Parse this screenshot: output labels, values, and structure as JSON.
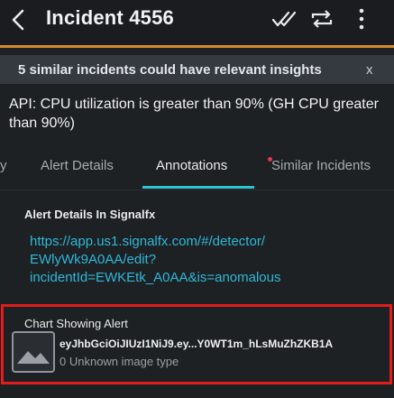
{
  "header": {
    "title": "Incident 4556",
    "back_icon": "chevron-left-icon",
    "actions": [
      "acknowledge-icon",
      "repeat-icon",
      "more-vertical-icon"
    ]
  },
  "banner": {
    "text": "5 similar incidents could have relevant insights",
    "close": "x"
  },
  "incident": {
    "title": "API: CPU utilization is greater than 90% (GH CPU greater than 90%)"
  },
  "tabs": [
    {
      "label": "y",
      "active": false
    },
    {
      "label": "Alert Details",
      "active": false
    },
    {
      "label": "Annotations",
      "active": true
    },
    {
      "label": "Similar Incidents",
      "active": false,
      "has_dot": true
    }
  ],
  "annotations": {
    "sections": [
      {
        "heading": "Alert Details In Signalfx",
        "link_lines": [
          "https://app.us1.signalfx.com/#/detector/",
          "EWlyWk9A0AA/edit?",
          "incidentId=EWKEtk_A0AA&is=anomalous"
        ]
      },
      {
        "heading": "Chart Showing Alert",
        "file": {
          "name": "eyJhbGciOiJIUzI1NiJ9.ey...Y0WT1m_hLsMuZhZKB1A",
          "meta": "0 Unknown image type",
          "icon": "image-icon"
        }
      }
    ]
  },
  "colors": {
    "accent": "#d68d2b",
    "tab_active": "#2ec4cf",
    "link": "#2eb8d9",
    "highlight": "#e11c1c",
    "notification_dot": "#e8334a"
  }
}
